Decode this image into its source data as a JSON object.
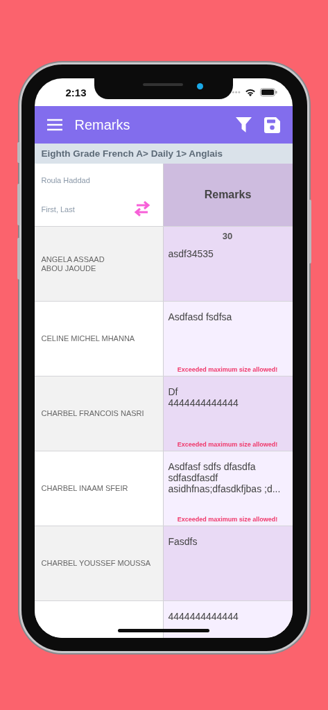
{
  "status_bar": {
    "time": "2:13"
  },
  "header": {
    "title": "Remarks"
  },
  "breadcrumb": "Eighth Grade French A> Daily 1> Anglais",
  "table": {
    "teacher": "Roula Haddad",
    "name_order": "First, Last",
    "column_title": "Remarks",
    "rows": [
      {
        "name": "ANGELA ASSAAD\nABOU JAOUDE",
        "counter": "30",
        "remark": "asdf34535"
      },
      {
        "name": "CELINE MICHEL MHANNA",
        "remark": "Asdfasd fsdfsa",
        "error": "Exceeded maximum size allowed!"
      },
      {
        "name": "CHARBEL FRANCOIS NASRI",
        "remark": "Df\n4444444444444",
        "error": "Exceeded maximum size allowed!"
      },
      {
        "name": "CHARBEL INAAM SFEIR",
        "remark": "Asdfasf sdfs dfasdfa\nsdfasdfasdf\nasidhfnas;dfasdkfjbas ;d...",
        "error": "Exceeded maximum size allowed!"
      },
      {
        "name": "CHARBEL YOUSSEF MOUSSA",
        "remark": "Fasdfs"
      },
      {
        "remark": "4444444444444"
      }
    ]
  }
}
